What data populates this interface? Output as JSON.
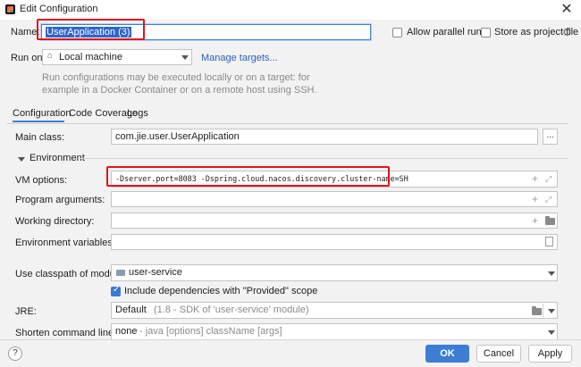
{
  "window": {
    "title": "Edit Configuration",
    "close_glyph": "✕"
  },
  "name_row": {
    "label": "Name:",
    "value": "UserApplication (3)"
  },
  "options": {
    "allow_parallel": "Allow parallel run",
    "store_as_file": "Store as project file"
  },
  "run_on": {
    "label": "Run on:",
    "target": "Local machine",
    "manage_link": "Manage targets...",
    "hint_line1": "Run configurations may be executed locally or on a target: for",
    "hint_line2": "example in a Docker Container or on a remote host using SSH."
  },
  "tabs": [
    "Configuration",
    "Code Coverage",
    "Logs"
  ],
  "main_class": {
    "label": "Main class:",
    "value": "com.jie.user.UserApplication",
    "browse": "..."
  },
  "environment": {
    "section_label": "Environment",
    "vm_options": {
      "label": "VM options:",
      "value": "-Dserver.port=8083 -Dspring.cloud.nacos.discovery.cluster-name=SH"
    },
    "program_arguments": {
      "label": "Program arguments:",
      "value": ""
    },
    "working_directory": {
      "label": "Working directory:",
      "value": ""
    },
    "env_variables": {
      "label": "Environment variables:",
      "value": ""
    }
  },
  "classpath": {
    "label": "Use classpath of module:",
    "value": "user-service"
  },
  "include_provided": {
    "label": "Include dependencies with \"Provided\" scope",
    "checked": true
  },
  "jre": {
    "label": "JRE:",
    "value": "Default",
    "detail": "(1.8 - SDK of 'user-service' module)"
  },
  "shorten": {
    "label": "Shorten command line:",
    "value": "none",
    "detail": "- java [options] className [args]"
  },
  "buttons": {
    "help": "?",
    "ok": "OK",
    "cancel": "Cancel",
    "apply": "Apply"
  },
  "colors": {
    "accent": "#3b7ed3",
    "highlight_box": "#e0141e",
    "link": "#2a5fbd"
  }
}
